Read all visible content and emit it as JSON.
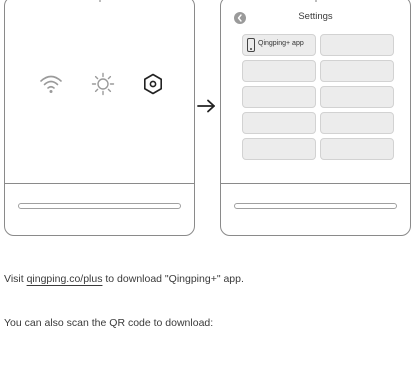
{
  "settings_screen": {
    "title": "Settings",
    "app_tile_label": "Qingping+ app",
    "empty_tiles": 9
  },
  "instructions": {
    "line1_prefix": "Visit ",
    "line1_link": "qingping.co/plus",
    "line1_suffix": " to download \"Qingping+\" app.",
    "line2": "You can also scan the QR code to download:"
  },
  "icons": {
    "device_icons": [
      "wifi-icon",
      "brightness-icon",
      "settings-icon"
    ],
    "transition": "arrow-right-icon",
    "back": "back-icon"
  }
}
